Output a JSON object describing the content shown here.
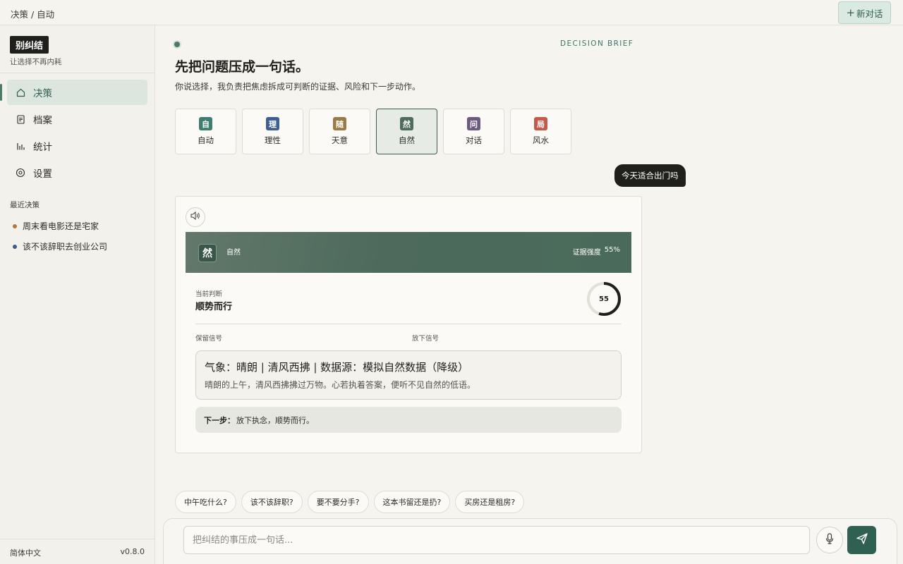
{
  "header": {
    "breadcrumb": "决策 / 自动",
    "new_chat_label": "新对话"
  },
  "sidebar": {
    "brand": "别纠结",
    "tagline": "让选择不再内耗",
    "nav": [
      {
        "label": "决策",
        "icon": "home-icon",
        "active": true
      },
      {
        "label": "档案",
        "icon": "document-icon",
        "active": false
      },
      {
        "label": "统计",
        "icon": "bar-chart-icon",
        "active": false
      },
      {
        "label": "设置",
        "icon": "gear-icon",
        "active": false
      }
    ],
    "recent_title": "最近决策",
    "recent": [
      {
        "label": "周末看电影还是宅家",
        "color": "#b3743e"
      },
      {
        "label": "该不该辞职去创业公司",
        "color": "#3d5a8a"
      }
    ],
    "language": "简体中文",
    "version": "v0.8.0"
  },
  "main": {
    "brief_tag": "DECISION BRIEF",
    "headline": "先把问题压成一句话。",
    "subline": "你说选择，我负责把焦虑拆成可判断的证据、风险和下一步动作。",
    "modes": [
      {
        "badge": "自",
        "label": "自动",
        "color": "#3f7d70"
      },
      {
        "badge": "理",
        "label": "理性",
        "color": "#3f5f94"
      },
      {
        "badge": "随",
        "label": "天意",
        "color": "#9a7b45"
      },
      {
        "badge": "然",
        "label": "自然",
        "color": "#4e6b5b"
      },
      {
        "badge": "问",
        "label": "对话",
        "color": "#6e5a7e"
      },
      {
        "badge": "局",
        "label": "风水",
        "color": "#c35a4a"
      }
    ],
    "active_mode": 3,
    "user_message": "今天适合出门吗",
    "card": {
      "badge": "然",
      "mode_name": "自然",
      "strength_label": "证据强度",
      "strength_value": "55%",
      "strength_fraction": 0.55,
      "judgment_label": "当前判断",
      "judgment": "顺势而行",
      "score": "55",
      "keep_label": "保留信号",
      "drop_label": "放下信号",
      "evidence_title": "气象：晴朗 | 清风西拂 | 数据源：模拟自然数据（降级）",
      "evidence_desc": "晴朗的上午，清风西拂拂过万物。心若执着答案，便听不见自然的低语。",
      "next_label": "下一步：",
      "next_text": "放下执念，顺势而行。"
    },
    "suggestions": [
      "中午吃什么?",
      "该不该辞职?",
      "要不要分手?",
      "这本书留还是扔?",
      "买房还是租房?"
    ],
    "composer": {
      "placeholder": "把纠结的事压成一句话..."
    }
  }
}
